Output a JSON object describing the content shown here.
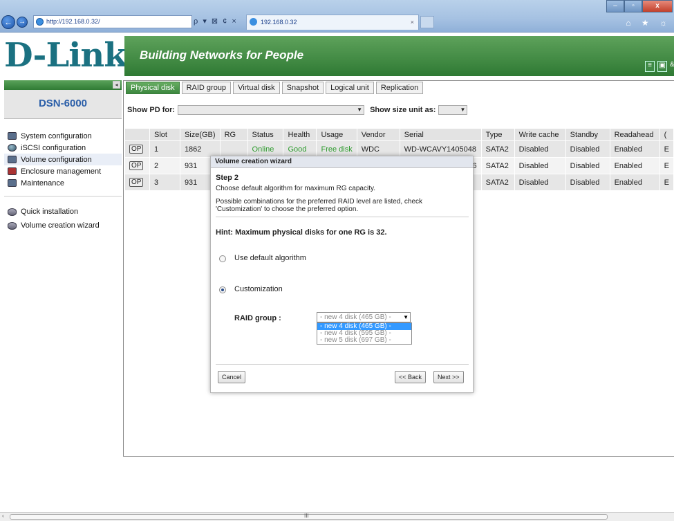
{
  "browser": {
    "address": "http://192.168.0.32/",
    "tab_title": "192.168.0.32",
    "tab_close": "×",
    "addr_tools": "ρ ▾ ⊠ ¢ ×",
    "win_min": "–",
    "win_max": "▫",
    "win_close": "x",
    "right_icons": "⌂ ★ ☼"
  },
  "header": {
    "logo": "D-Link",
    "logo_reg": "®",
    "tagline": "Building Networks for People"
  },
  "sidebar": {
    "collapse": "◂",
    "model": "DSN-6000",
    "items": [
      {
        "label": "System configuration"
      },
      {
        "label": "iSCSI configuration"
      },
      {
        "label": "Volume configuration"
      },
      {
        "label": "Enclosure management"
      },
      {
        "label": "Maintenance"
      }
    ],
    "quick": [
      {
        "label": "Quick installation"
      },
      {
        "label": "Volume creation wizard"
      }
    ]
  },
  "main": {
    "tabs": [
      "Physical disk",
      "RAID group",
      "Virtual disk",
      "Snapshot",
      "Logical unit",
      "Replication"
    ],
    "show_pd_label": "Show PD for:",
    "show_size_label": "Show size unit as:",
    "columns": [
      "",
      "Slot",
      "Size(GB)",
      "RG",
      "Status",
      "Health",
      "Usage",
      "Vendor",
      "Serial",
      "Type",
      "Write cache",
      "Standby",
      "Readahead",
      "("
    ],
    "rows": [
      {
        "op": "OP",
        "slot": "1",
        "size": "1862",
        "rg": "",
        "status": "Online",
        "health": "Good",
        "usage": "Free disk",
        "vendor": "WDC",
        "serial": "WD-WCAVY1405048",
        "type": "SATA2",
        "wc": "Disabled",
        "standby": "Disabled",
        "readahead": "Enabled",
        "more": "E"
      },
      {
        "op": "OP",
        "slot": "2",
        "size": "931",
        "rg": "",
        "status": "",
        "health": "",
        "usage": "",
        "vendor": "",
        "serial": "96",
        "type": "SATA2",
        "wc": "Disabled",
        "standby": "Disabled",
        "readahead": "Enabled",
        "more": "E"
      },
      {
        "op": "OP",
        "slot": "3",
        "size": "931",
        "rg": "",
        "status": "",
        "health": "",
        "usage": "",
        "vendor": "",
        "serial": "",
        "type": "SATA2",
        "wc": "Disabled",
        "standby": "Disabled",
        "readahead": "Enabled",
        "more": "E"
      }
    ]
  },
  "modal": {
    "title": "Volume creation wizard",
    "step": "Step 2",
    "desc": "Choose default algorithm for maximum RG capacity.",
    "note": "Possible combinations for the preferred RAID level are listed, check 'Customization' to choose the preferred option.",
    "hint": "Hint: Maximum physical disks for one RG is 32.",
    "opt_default": "Use default algorithm",
    "opt_custom": "Customization",
    "raid_label": "RAID group :",
    "raid_selected": "- new 4 disk (465 GB) -",
    "raid_options": [
      "- new 4 disk (465 GB) -",
      "- new 4 disk (595 GB) -",
      "- new 5 disk (697 GB) -"
    ],
    "cancel": "Cancel",
    "back": "<< Back",
    "next": "Next >>"
  },
  "scroll": {
    "grip": "III",
    "left": "‹"
  }
}
